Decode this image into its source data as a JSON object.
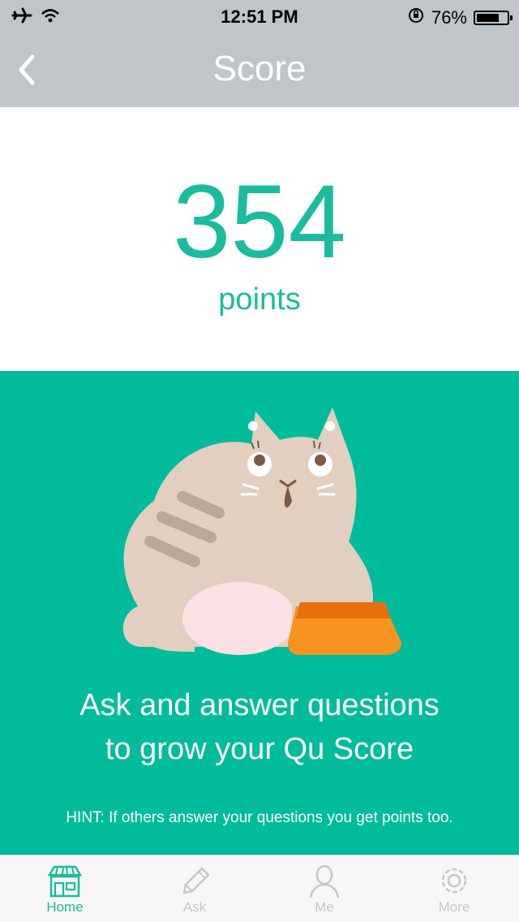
{
  "status_bar": {
    "time": "12:51 PM",
    "battery_percent": "76%",
    "battery_level": 0.76,
    "icons": [
      "airplane-mode-icon",
      "wifi-icon",
      "orientation-lock-icon",
      "battery-icon"
    ]
  },
  "nav": {
    "title": "Score",
    "back_icon": "chevron-left-icon"
  },
  "score": {
    "value": "354",
    "unit": "points"
  },
  "promo": {
    "illustration": "cat-with-bowl",
    "message_line1": "Ask and answer questions",
    "message_line2": "to grow your Qu Score",
    "hint": "HINT: If others answer your questions you get points too."
  },
  "tabs": [
    {
      "label": "Home",
      "icon": "storefront-icon",
      "active": true
    },
    {
      "label": "Ask",
      "icon": "pencil-icon",
      "active": false
    },
    {
      "label": "Me",
      "icon": "person-icon",
      "active": false
    },
    {
      "label": "More",
      "icon": "gear-icon",
      "active": false
    }
  ],
  "colors": {
    "accent": "#1abc9c",
    "panel_green": "#00bc9b",
    "nav_gray": "#bfc5c9",
    "inactive_gray": "#c7c7c7"
  }
}
